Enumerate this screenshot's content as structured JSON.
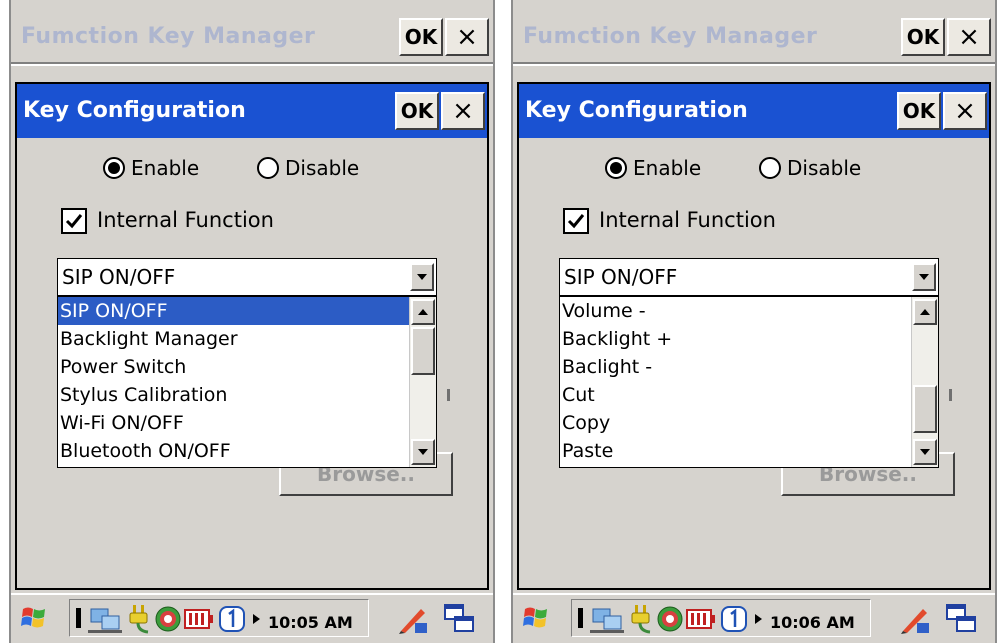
{
  "app": {
    "title": "Fumction Key Manager",
    "ok_label": "OK",
    "close_label": "×"
  },
  "dialog": {
    "title": "Key Configuration",
    "ok_label": "OK",
    "close_label": "×",
    "enable_label": "Enable",
    "disable_label": "Disable",
    "mode_selected": "Enable",
    "internal_function_label": "Internal Function",
    "internal_function_checked": true,
    "browse_label": "Browse.."
  },
  "left": {
    "combo_value": "SIP ON/OFF",
    "items": [
      "SIP ON/OFF",
      "Backlight Manager",
      "Power Switch",
      "Stylus Calibration",
      "Wi-Fi ON/OFF",
      "Bluetooth ON/OFF"
    ],
    "selected_item": "SIP ON/OFF",
    "clock": "10:05 AM",
    "scroll_position": 0.0
  },
  "right": {
    "combo_value": "SIP ON/OFF",
    "items": [
      "Volume -",
      "Backlight +",
      "Baclight -",
      "Cut",
      "Copy",
      "Paste"
    ],
    "clock": "10:06 AM",
    "scroll_position": 0.85
  },
  "taskbar": {
    "icons": [
      "start-flag-icon",
      "keyboard-toggle-icon",
      "network-icon",
      "power-plug-icon",
      "wireless-icon",
      "battery-icon",
      "input-one-icon",
      "tray-expand-icon"
    ],
    "right_icons": [
      "pen-input-icon",
      "switch-window-icon"
    ]
  },
  "colors": {
    "dialog_title_bg": "#1a52d2",
    "selection_bg": "#2c5cc5",
    "app_title_fg": "#aeb6cf"
  }
}
